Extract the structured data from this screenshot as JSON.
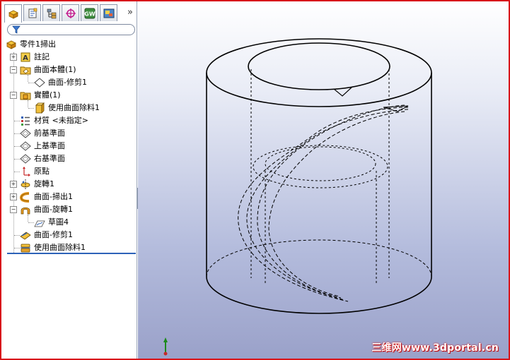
{
  "feature_tree": {
    "root": {
      "label": "零件1掃出",
      "icon": "part-icon"
    },
    "items": [
      {
        "label": "註記",
        "icon": "annotations-icon",
        "expander": "+"
      },
      {
        "label": "曲面本體(1)",
        "icon": "surface-bodies-folder-icon",
        "expander": "−"
      },
      {
        "label": "曲面-修剪1",
        "icon": "surface-body-icon"
      },
      {
        "label": "實體(1)",
        "icon": "solid-bodies-folder-icon",
        "expander": "−"
      },
      {
        "label": "使用曲面除料1",
        "icon": "solid-body-icon"
      },
      {
        "label": "材質 <未指定>",
        "icon": "material-icon"
      },
      {
        "label": "前基準面",
        "icon": "plane-icon"
      },
      {
        "label": "上基準面",
        "icon": "plane-icon"
      },
      {
        "label": "右基準面",
        "icon": "plane-icon"
      },
      {
        "label": "原點",
        "icon": "origin-icon"
      },
      {
        "label": "旋轉1",
        "icon": "revolve-icon",
        "expander": "+"
      },
      {
        "label": "曲面-掃出1",
        "icon": "surface-sweep-icon",
        "expander": "+"
      },
      {
        "label": "曲面-旋轉1",
        "icon": "surface-revolve-icon",
        "expander": "−"
      },
      {
        "label": "草圖4",
        "icon": "sketch-icon"
      },
      {
        "label": "曲面-修剪1",
        "icon": "surface-trim-icon"
      },
      {
        "label": "使用曲面除料1",
        "icon": "surface-cut-icon"
      }
    ]
  },
  "tabs": [
    {
      "name": "feature-manager-tab",
      "icon": "feature-manager-icon"
    },
    {
      "name": "property-manager-tab",
      "icon": "property-manager-icon"
    },
    {
      "name": "configuration-manager-tab",
      "icon": "configuration-manager-icon"
    },
    {
      "name": "dimxpert-manager-tab",
      "icon": "dimxpert-icon"
    },
    {
      "name": "add-in-tab",
      "icon": "add-in-icon"
    },
    {
      "name": "display-manager-tab",
      "icon": "display-manager-icon"
    }
  ],
  "tab_overflow": "»",
  "watermark": "三维网www.3dportal.cn",
  "colors": {
    "frame_border": "#d8141a",
    "rollback_bar": "#2d62b8",
    "viewport_top": "#ffffff",
    "viewport_bottom": "#9aa1c9"
  }
}
